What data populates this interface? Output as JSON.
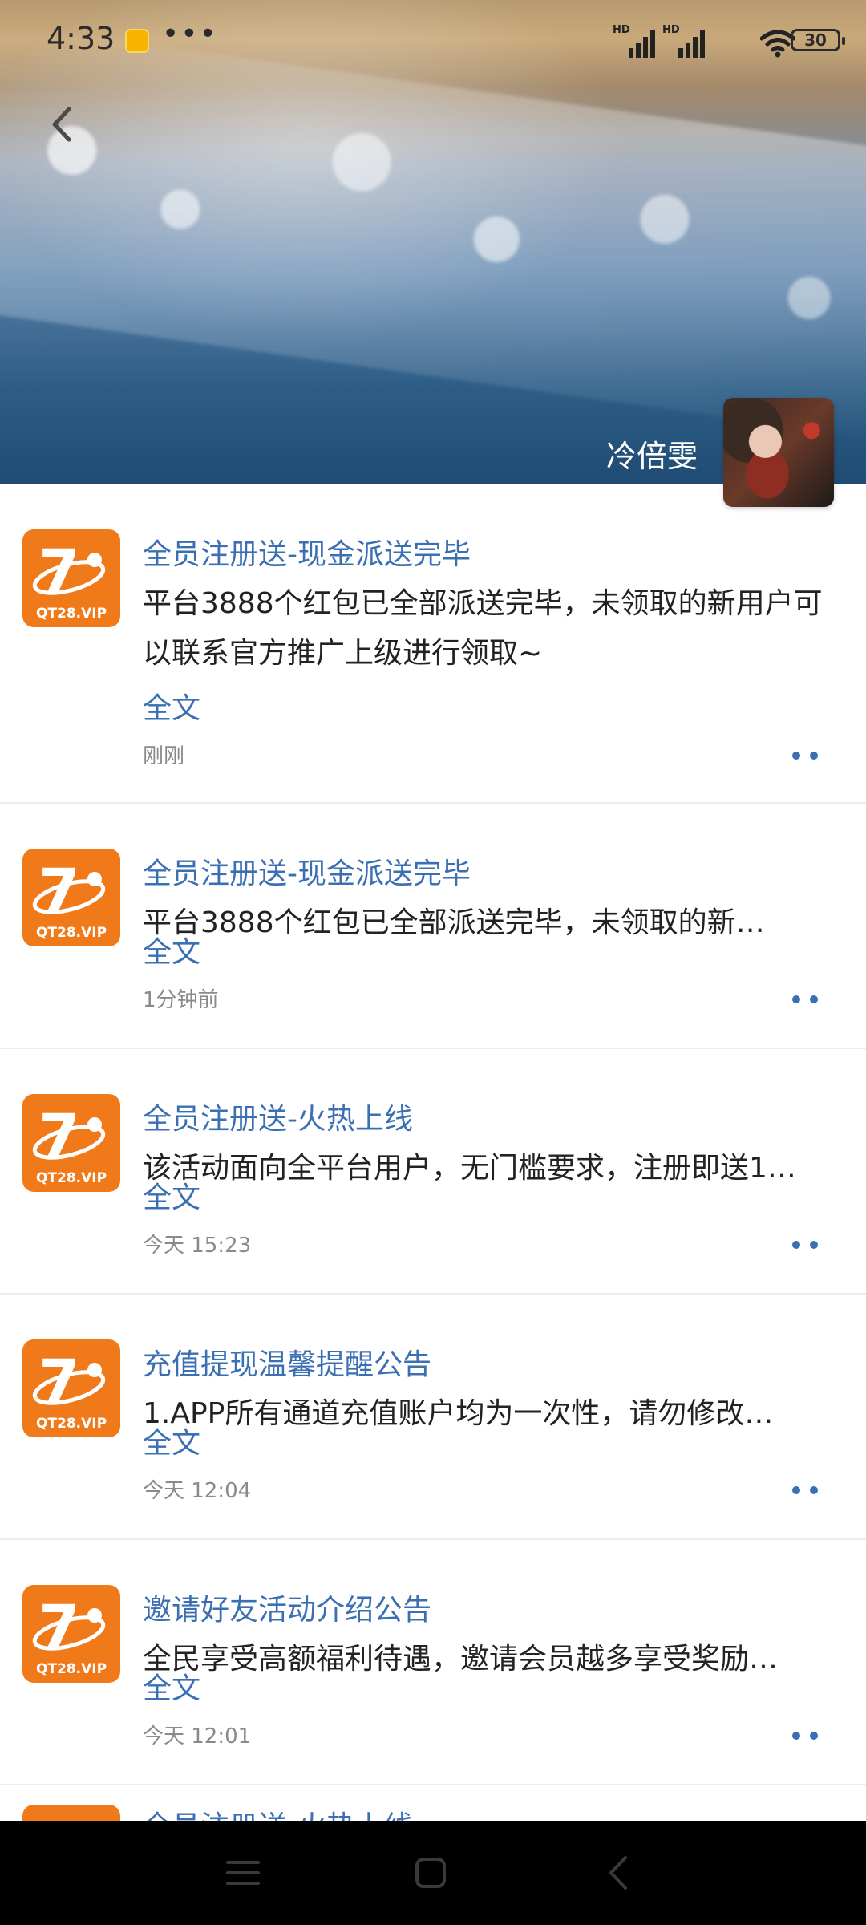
{
  "status_bar": {
    "time": "4:33",
    "more": "•••",
    "signal1_label": "HD",
    "signal2_label": "HD",
    "battery": "30"
  },
  "profile": {
    "name": "冷倍雯"
  },
  "posts": [
    {
      "title": "全员注册送-现金派送完毕",
      "body": "平台3888个红包已全部派送完毕，未领取的新用户可以联系官方推广上级进行领取~",
      "fulltext": "全文",
      "time": "刚刚"
    },
    {
      "title": "全员注册送-现金派送完毕",
      "body": "平台3888个红包已全部派送完毕，未领取的新…",
      "fulltext": "全文",
      "time": "1分钟前"
    },
    {
      "title": "全员注册送-火热上线",
      "body": "该活动面向全平台用户，无门槛要求，注册即送1…",
      "fulltext": "全文",
      "time": "今天 15:23"
    },
    {
      "title": "充值提现温馨提醒公告",
      "body": "1.APP所有通道充值账户均为一次性，请勿修改…",
      "fulltext": "全文",
      "time": "今天 12:04"
    },
    {
      "title": "邀请好友活动介绍公告",
      "body": "全民享受高额福利待遇，邀请会员越多享受奖励…",
      "fulltext": "全文",
      "time": "今天 12:01"
    },
    {
      "title": "全员注册送-火热上线"
    }
  ],
  "logo": {
    "text": "QT28.VIP",
    "numeral": "7",
    "color": "#f07a1a"
  },
  "colors": {
    "link": "#3b6fb3",
    "body_text": "#222222",
    "meta_text": "#8a8a8a",
    "navbar": "#000000"
  }
}
